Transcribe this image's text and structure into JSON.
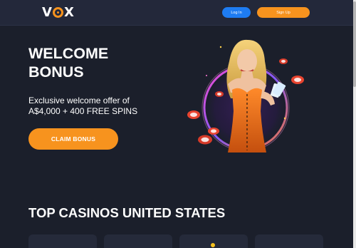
{
  "header": {
    "logo_text": "VOX",
    "login_label": "Log In",
    "signup_label": "Sign Up"
  },
  "hero": {
    "title_line1": "WELCOME",
    "title_line2": "BONUS",
    "subtitle_line1": "Exclusive welcome offer of",
    "subtitle_line2": "A$4,000 + 400 FREE SPINS",
    "cta_label": "CLAIM BONUS"
  },
  "section": {
    "title": "TOP CASINOS UNITED STATES"
  },
  "colors": {
    "background": "#1b1f2b",
    "header": "#23283a",
    "accent_orange": "#f7931e",
    "accent_blue": "#1e7cf2",
    "card": "#252a3a"
  },
  "icons": [
    "casino-logo-icon",
    "casino-logo-icon",
    "casino-logo-icon",
    "casino-logo-icon"
  ]
}
